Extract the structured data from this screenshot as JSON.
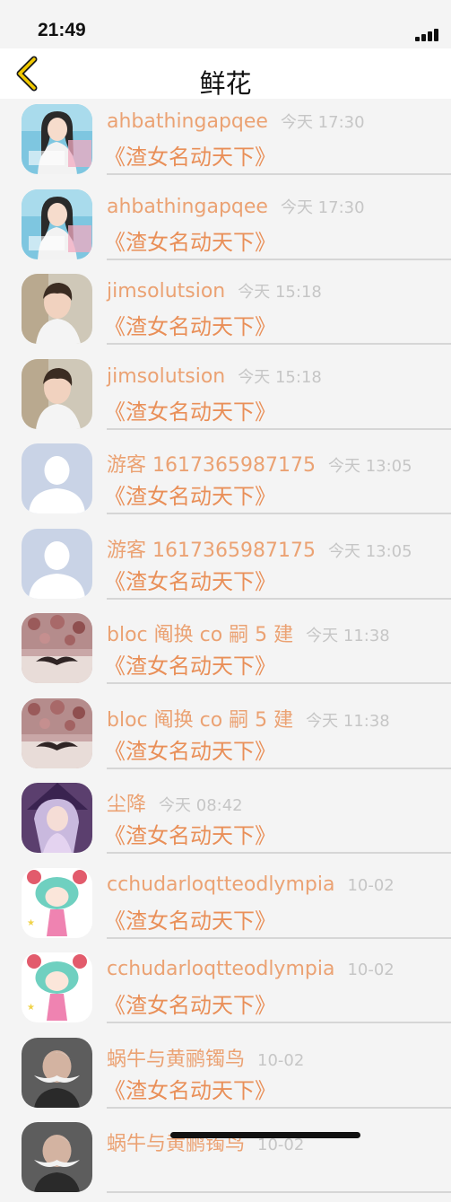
{
  "status_bar": {
    "time": "21:49"
  },
  "nav": {
    "title": "鲜花",
    "back_icon": "chevron-left-icon"
  },
  "items": [
    {
      "name": "ahbathingapqee",
      "time": "今天 17:30",
      "gift": "《渣女名动天下》",
      "avatar": "girl-photo"
    },
    {
      "name": "ahbathingapqee",
      "time": "今天 17:30",
      "gift": "《渣女名动天下》",
      "avatar": "girl-photo"
    },
    {
      "name": "jimsolutsion",
      "time": "今天 15:18",
      "gift": "《渣女名动天下》",
      "avatar": "boy-photo"
    },
    {
      "name": "jimsolutsion",
      "time": "今天 15:18",
      "gift": "《渣女名动天下》",
      "avatar": "boy-photo"
    },
    {
      "name": "游客 1617365987175",
      "time": "今天 13:05",
      "gift": "《渣女名动天下》",
      "avatar": "default-user"
    },
    {
      "name": "游客 1617365987175",
      "time": "今天 13:05",
      "gift": "《渣女名动天下》",
      "avatar": "default-user"
    },
    {
      "name": "bloc 阄换 co 嗣 5 建",
      "time": "今天 11:38",
      "gift": "《渣女名动天下》",
      "avatar": "mustache"
    },
    {
      "name": "bloc 阄换 co 嗣 5 建",
      "time": "今天 11:38",
      "gift": "《渣女名动天下》",
      "avatar": "mustache"
    },
    {
      "name": "尘降",
      "time": "今天 08:42",
      "gift": "《渣女名动天下》",
      "avatar": "anime-girl"
    },
    {
      "name": "cchudarloqtteodlympia",
      "time": "10-02",
      "gift": "《渣女名动天下》",
      "avatar": "chibi"
    },
    {
      "name": "cchudarloqtteodlympia",
      "time": "10-02",
      "gift": "《渣女名动天下》",
      "avatar": "chibi"
    },
    {
      "name": "蜗牛与黄鹂镯鸟",
      "time": "10-02",
      "gift": "《渣女名动天下》",
      "avatar": "old-man"
    },
    {
      "name": "蜗牛与黄鹂镯鸟",
      "time": "10-02",
      "gift": "",
      "avatar": "old-man"
    }
  ]
}
